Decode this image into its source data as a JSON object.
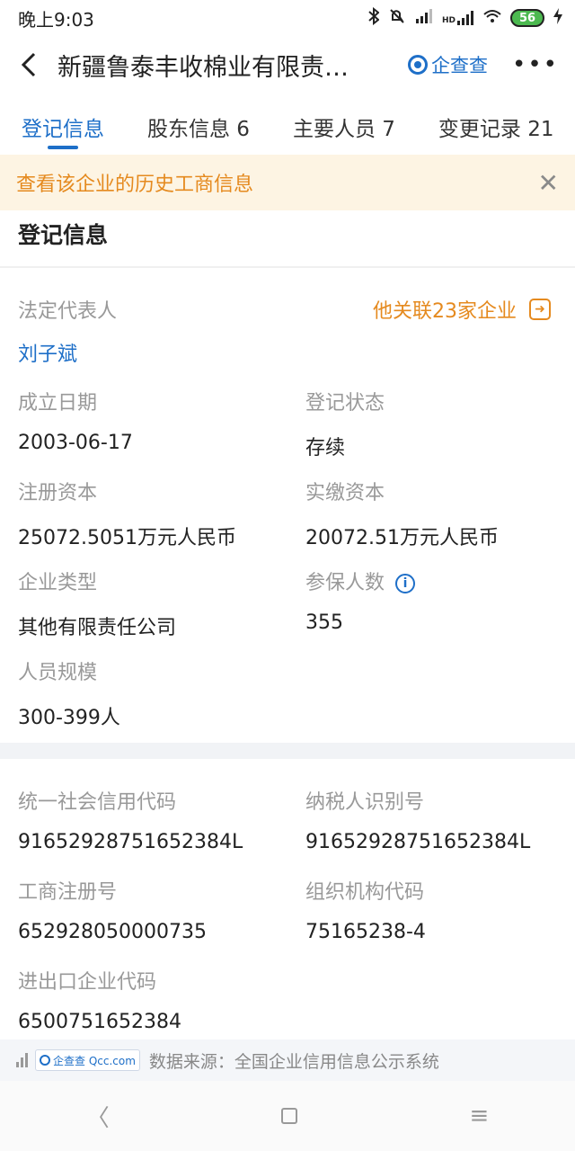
{
  "status_bar": {
    "time": "晚上9:03",
    "network_label": "HD",
    "battery": "56"
  },
  "nav": {
    "title": "新疆鲁泰丰收棉业有限责…",
    "brand": "企查查",
    "more": "•••"
  },
  "tabs": [
    {
      "label": "登记信息",
      "active": true
    },
    {
      "label": "股东信息 6"
    },
    {
      "label": "主要人员 7"
    },
    {
      "label": "变更记录 21"
    }
  ],
  "banner": {
    "text": "查看该企业的历史工商信息",
    "close": "✕"
  },
  "section": {
    "title": "登记信息"
  },
  "legal_rep": {
    "label": "法定代表人",
    "value": "刘子斌",
    "related_link": "他关联23家企业"
  },
  "fields": {
    "established_date": {
      "label": "成立日期",
      "value": "2003-06-17"
    },
    "reg_status": {
      "label": "登记状态",
      "value": "存续"
    },
    "registered_capital": {
      "label": "注册资本",
      "value": "25072.5051万元人民币"
    },
    "paid_in_capital": {
      "label": "实缴资本",
      "value": "20072.51万元人民币"
    },
    "company_type": {
      "label": "企业类型",
      "value": "其他有限责任公司"
    },
    "insured_count": {
      "label": "参保人数",
      "value": "355"
    },
    "staff_size": {
      "label": "人员规模",
      "value": "300-399人"
    },
    "credit_code": {
      "label": "统一社会信用代码",
      "value": "91652928751652384L"
    },
    "taxpayer_id": {
      "label": "纳税人识别号",
      "value": "91652928751652384L"
    },
    "business_reg_no": {
      "label": "工商注册号",
      "value": "652928050000735"
    },
    "org_code": {
      "label": "组织机构代码",
      "value": "75165238-4"
    },
    "import_export_code": {
      "label": "进出口企业代码",
      "value": "6500751652384"
    }
  },
  "footer": {
    "badge": "企查查 Qcc.com",
    "source_text": "数据来源：全国企业信用信息公示系统"
  },
  "system_nav": {
    "back": "〈",
    "menu": "≡"
  }
}
